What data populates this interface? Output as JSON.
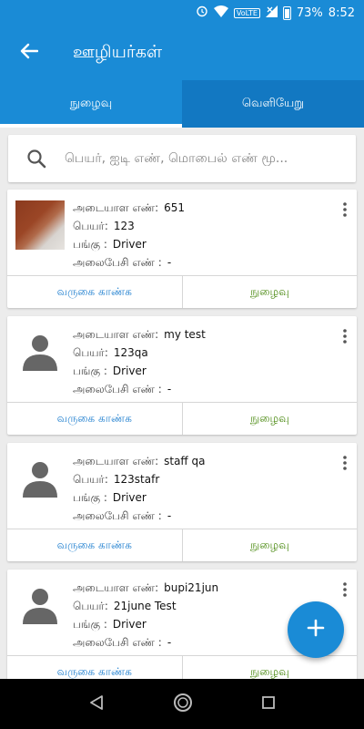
{
  "status_bar": {
    "battery": "73%",
    "time": "8:52",
    "volte": "VoLTE"
  },
  "app_bar": {
    "title": "ஊழியர்கள்"
  },
  "tabs": [
    {
      "label": "நுழைவு",
      "active": true
    },
    {
      "label": "வெளியேறு",
      "active": false
    }
  ],
  "search": {
    "placeholder": "பெயர், ஐடி எண், மொபைல் எண் மூ..."
  },
  "labels": {
    "id": "அடையாள எண்:",
    "name": "பெயர்:",
    "role": "பங்கு :",
    "mobile": "அலைபேசி எண் :",
    "view_attendance": "வருகை காண்க",
    "checkin": "நுழைவு"
  },
  "employees": [
    {
      "id": "651",
      "name": "123",
      "role": "Driver",
      "mobile": "-",
      "avatar": "photo"
    },
    {
      "id": "my test",
      "name": "123qa",
      "role": "Driver",
      "mobile": "-",
      "avatar": "silhouette"
    },
    {
      "id": "staff qa",
      "name": "123stafr",
      "role": "Driver",
      "mobile": "-",
      "avatar": "silhouette"
    },
    {
      "id": "bupi21jun",
      "name": "21june Test",
      "role": "Driver",
      "mobile": "-",
      "avatar": "silhouette"
    }
  ],
  "colors": {
    "primary": "#1a8bd6",
    "link_blue": "#1f7fcf",
    "link_green": "#4b8a12"
  },
  "icons": {
    "back": "arrow-back-icon",
    "search": "search-icon",
    "more": "more-vert-icon",
    "fab": "plus-icon"
  }
}
